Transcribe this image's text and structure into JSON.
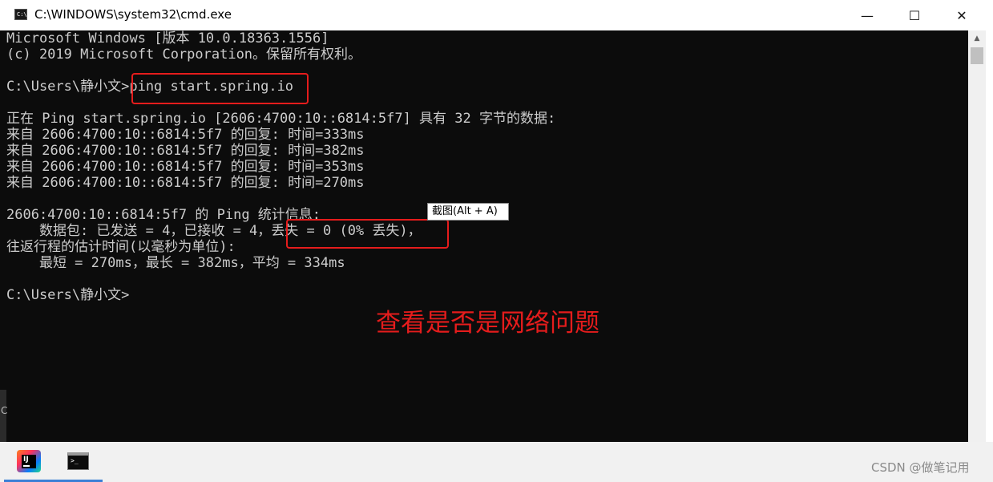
{
  "window": {
    "title": "C:\\WINDOWS\\system32\\cmd.exe",
    "icon": "cmd-icon",
    "controls": {
      "minimize": "—",
      "maximize": "☐",
      "close": "✕"
    }
  },
  "console": {
    "lines": [
      "Microsoft Windows [版本 10.0.18363.1556]",
      "(c) 2019 Microsoft Corporation。保留所有权利。",
      "",
      "C:\\Users\\静小文>ping start.spring.io",
      "",
      "正在 Ping start.spring.io [2606:4700:10::6814:5f7] 具有 32 字节的数据:",
      "来自 2606:4700:10::6814:5f7 的回复: 时间=333ms",
      "来自 2606:4700:10::6814:5f7 的回复: 时间=382ms",
      "来自 2606:4700:10::6814:5f7 的回复: 时间=353ms",
      "来自 2606:4700:10::6814:5f7 的回复: 时间=270ms",
      "",
      "2606:4700:10::6814:5f7 的 Ping 统计信息:",
      "    数据包: 已发送 = 4，已接收 = 4，丢失 = 0 (0% 丢失)，",
      "往返行程的估计时间(以毫秒为单位):",
      "    最短 = 270ms，最长 = 382ms，平均 = 334ms",
      "",
      "C:\\Users\\静小文>"
    ],
    "fg_color": "#cccccc",
    "bg_color": "#0c0c0c"
  },
  "tooltip": {
    "text": "截图(Alt + A)"
  },
  "annotation": {
    "text": "查看是否是网络问题",
    "color": "#e51c1c"
  },
  "left_strip": {
    "text": "C"
  },
  "taskbar": {
    "apps": [
      {
        "name": "intellij-idea",
        "icon": "intellij-idea-icon",
        "glyph": "IJ"
      },
      {
        "name": "cmd",
        "icon": "cmd-icon",
        "glyph": ">_"
      }
    ]
  },
  "watermark": {
    "text": "CSDN @做笔记用"
  }
}
